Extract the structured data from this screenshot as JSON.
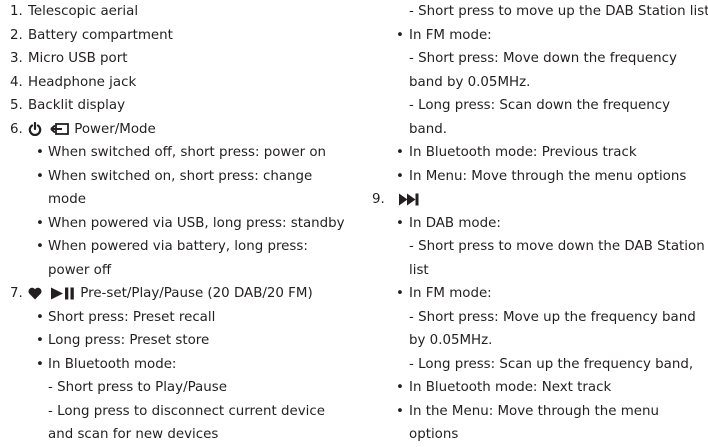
{
  "left": {
    "items": [
      {
        "num": "1.",
        "text": "Telescopic aerial"
      },
      {
        "num": "2.",
        "text": "Battery compartment"
      },
      {
        "num": "3.",
        "text": "Micro USB port"
      },
      {
        "num": "4.",
        "text": "Headphone jack"
      },
      {
        "num": "5.",
        "text": "Backlit display"
      }
    ],
    "item6": {
      "num": "6.",
      "label": "Power/Mode",
      "icons": [
        "power-icon",
        "mode-input-icon"
      ],
      "bullets": [
        [
          "When switched off, short press: power on"
        ],
        [
          "When switched on, short press: change",
          "mode"
        ],
        [
          "When powered via USB, long press: standby"
        ],
        [
          "When powered via battery, long press:",
          "power off"
        ]
      ]
    },
    "item7": {
      "num": "7.",
      "label": "Pre-set/Play/Pause (20 DAB/20 FM)",
      "icons": [
        "heart-icon",
        "play-pause-icon"
      ],
      "bullets": [
        [
          "Short press: Preset recall"
        ],
        [
          "Long press: Preset store"
        ],
        [
          "In Bluetooth mode:",
          "- Short press to Play/Pause",
          "- Long press to disconnect current device",
          "and scan for new devices"
        ]
      ]
    }
  },
  "right": {
    "continued": [
      "- Short press to move up the DAB Station list"
    ],
    "bullets": [
      [
        "In FM mode:",
        "- Short press: Move down the frequency",
        "band by 0.05MHz.",
        "- Long press: Scan down the frequency",
        "band."
      ],
      [
        "In Bluetooth mode: Previous track"
      ],
      [
        "In Menu: Move through the menu options"
      ]
    ],
    "item9": {
      "num": "9.",
      "icons": [
        "skip-forward-icon"
      ],
      "bullets": [
        [
          "In DAB mode:",
          "- Short press to move down the DAB Station",
          "list"
        ],
        [
          "In FM mode:",
          "- Short press: Move up the frequency band",
          "by 0.05MHz.",
          "- Long press: Scan up the frequency band,"
        ],
        [
          "In Bluetooth mode: Next track"
        ],
        [
          "In the Menu: Move through the menu",
          "options"
        ]
      ]
    }
  },
  "bullet_char": "•",
  "colors": {
    "text": "#231f20",
    "background": "#ffffff"
  }
}
